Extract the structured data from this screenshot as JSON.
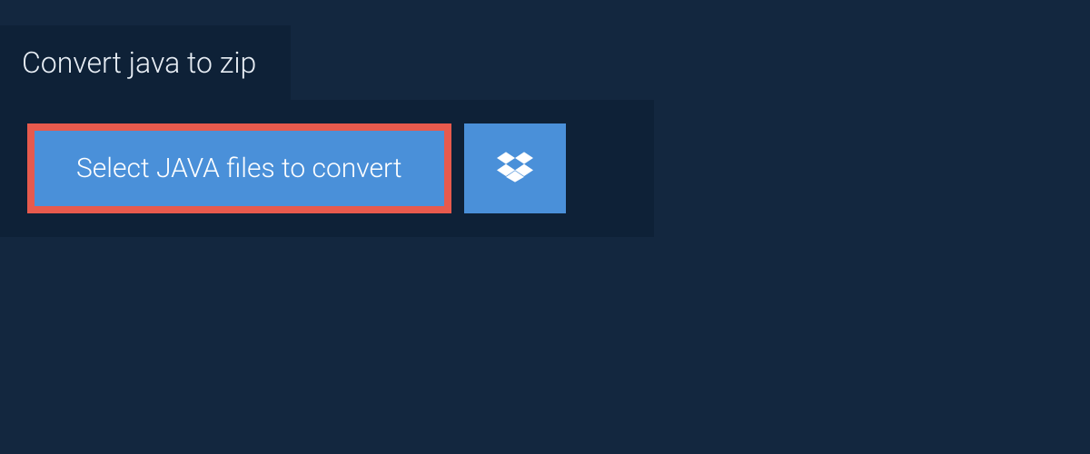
{
  "tab": {
    "title": "Convert java to zip"
  },
  "upload": {
    "select_label": "Select JAVA files to convert"
  }
}
